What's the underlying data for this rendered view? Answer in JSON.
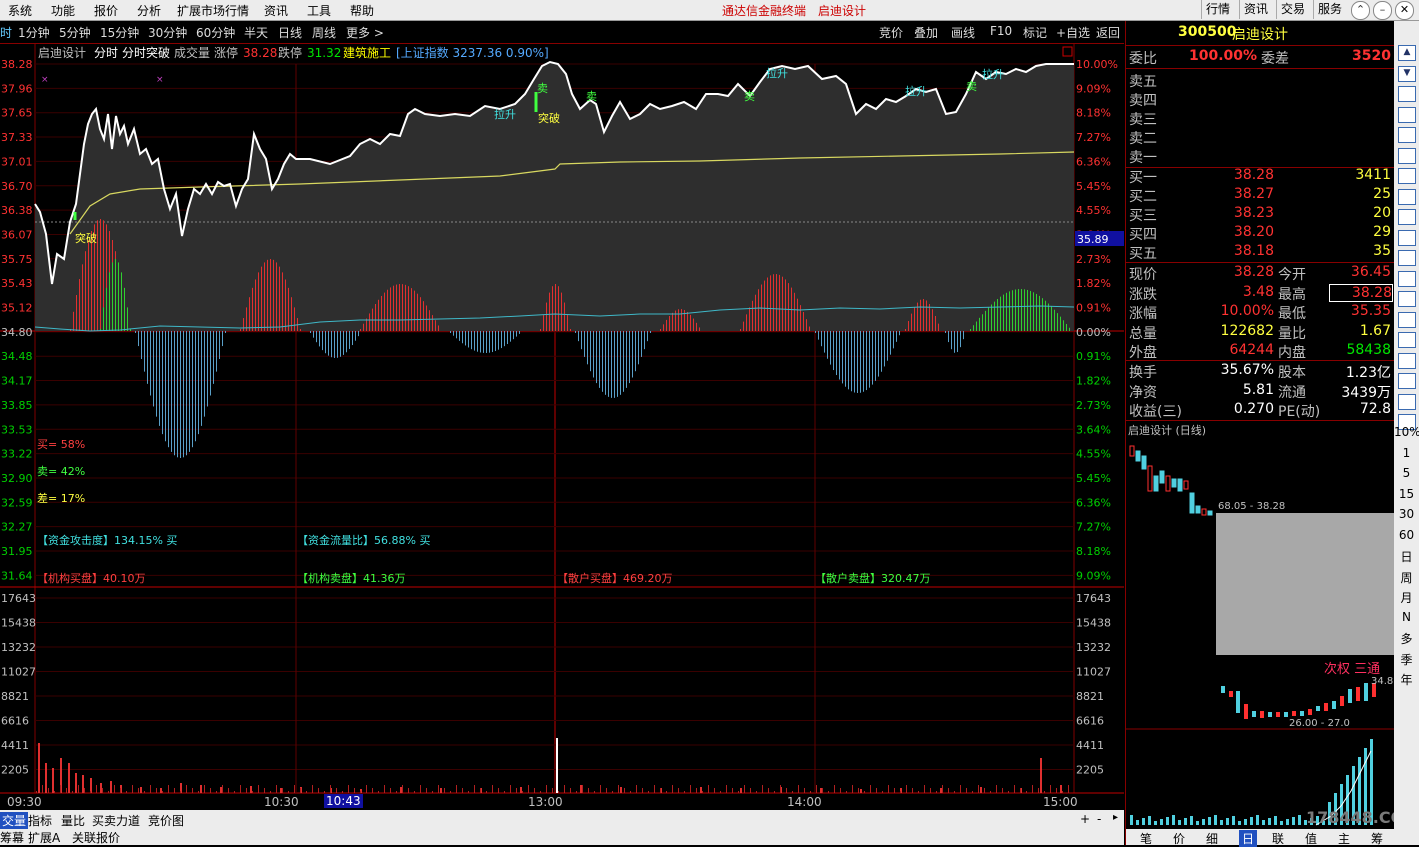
{
  "menubar": {
    "items": [
      "系统",
      "功能",
      "报价",
      "分析",
      "扩展市场行情",
      "资讯",
      "工具",
      "帮助"
    ],
    "title": "通达信金融终端",
    "stock": "启迪设计",
    "buttons": [
      "行情",
      "资讯",
      "交易",
      "服务"
    ]
  },
  "tabs": [
    "时",
    "1分钟",
    "5分钟",
    "15分钟",
    "30分钟",
    "60分钟",
    "半天",
    "日线",
    "周线",
    "更多 >"
  ],
  "tools": [
    "竞价",
    "叠加",
    "画线",
    "F10",
    "标记",
    "+自选",
    "返回"
  ],
  "chart_header": {
    "name": "启迪设计",
    "mode1": "分时",
    "mode2": "分时突破",
    "volume": "成交量",
    "limit_up_label": "涨停",
    "limit_up": "38.28",
    "limit_down_label": "跌停",
    "limit_down": "31.32",
    "sector": "建筑施工",
    "index": "[上证指数 3237.36 0.90%]"
  },
  "price_axis": [
    "38.28",
    "37.96",
    "37.65",
    "37.33",
    "37.01",
    "36.70",
    "36.38",
    "36.07",
    "35.75",
    "35.43",
    "35.12",
    "34.80",
    "34.48",
    "34.17",
    "33.85",
    "33.53",
    "33.22",
    "32.90",
    "32.59",
    "32.27",
    "31.95",
    "31.64"
  ],
  "pct_axis": [
    "10.00%",
    "9.09%",
    "8.18%",
    "7.27%",
    "6.36%",
    "5.45%",
    "4.55%",
    "3.64%",
    "2.73%",
    "1.82%",
    "0.91%",
    "0.00%",
    "0.91%",
    "1.82%",
    "2.73%",
    "3.64%",
    "4.55%",
    "5.45%",
    "6.36%",
    "7.27%",
    "8.18%",
    "9.09%"
  ],
  "vol_axis": [
    "17643",
    "15438",
    "13232",
    "11027",
    "8821",
    "6616",
    "4411",
    "2205"
  ],
  "cursor_price": "35.89",
  "chart_marks": [
    "突破",
    "突破",
    "拉升",
    "卖",
    "卖",
    "卖",
    "拉升",
    "拉升",
    "卖",
    "拉升"
  ],
  "stats": {
    "buy": "买= 58%",
    "sell": "卖= 42%",
    "diff": "差= 17%"
  },
  "funds": {
    "attack": "【资金攻击度】134.15% 买",
    "flow": "【资金流量比】56.88% 买",
    "inst_buy": "【机构买盘】40.10万",
    "inst_sell": "【机构卖盘】41.36万",
    "retail_buy": "【散户买盘】469.20万",
    "retail_sell": "【散户卖盘】320.47万"
  },
  "times": [
    "09:30",
    "10:30",
    "10:43",
    "13:00",
    "14:00",
    "15:00"
  ],
  "bottom_tabs": [
    "交量",
    "指标",
    "量比",
    "买卖力道",
    "竞价图"
  ],
  "bottom_tabs2": [
    "筹幕",
    "扩展A",
    "关联报价"
  ],
  "quote": {
    "code": "300500",
    "name": "启迪设计",
    "weibi_label": "委比",
    "weibi": "100.00%",
    "weicha_label": "委差",
    "weicha": "3520",
    "asks": [
      "卖五",
      "卖四",
      "卖三",
      "卖二",
      "卖一"
    ],
    "bids": [
      {
        "label": "买一",
        "price": "38.28",
        "vol": "3411"
      },
      {
        "label": "买二",
        "price": "38.27",
        "vol": "25"
      },
      {
        "label": "买三",
        "price": "38.23",
        "vol": "20"
      },
      {
        "label": "买四",
        "price": "38.20",
        "vol": "29"
      },
      {
        "label": "买五",
        "price": "38.18",
        "vol": "35"
      }
    ],
    "info": [
      {
        "l1": "现价",
        "v1": "38.28",
        "l2": "今开",
        "v2": "36.45"
      },
      {
        "l1": "涨跌",
        "v1": "3.48",
        "l2": "最高",
        "v2": "38.28"
      },
      {
        "l1": "涨幅",
        "v1": "10.00%",
        "l2": "最低",
        "v2": "35.35"
      },
      {
        "l1": "总量",
        "v1": "122682",
        "l2": "量比",
        "v2": "1.67"
      },
      {
        "l1": "外盘",
        "v1": "64244",
        "l2": "内盘",
        "v2": "58438"
      }
    ],
    "info2": [
      {
        "l1": "换手",
        "v1": "35.67%",
        "l2": "股本",
        "v2": "1.23亿"
      },
      {
        "l1": "净资",
        "v1": "5.81",
        "l2": "流通",
        "v2": "3439万"
      },
      {
        "l1": "收益(三)",
        "v1": "0.270",
        "l2": "PE(动)",
        "v2": "72.8"
      }
    ]
  },
  "mini": {
    "title": "启迪设计 (日线)",
    "range1": "68.05 - 38.28",
    "event": "次权 三通",
    "price": "34.8",
    "range2": "26.00 - 27.0"
  },
  "mini_tabs": [
    "笔",
    "价",
    "细",
    "日",
    "联",
    "值",
    "主",
    "筹"
  ],
  "side_text": [
    "10%",
    "1",
    "5",
    "15",
    "30",
    "60",
    "日",
    "周",
    "月",
    "N",
    "多",
    "季",
    "年"
  ],
  "watermark": "178448.COM"
}
